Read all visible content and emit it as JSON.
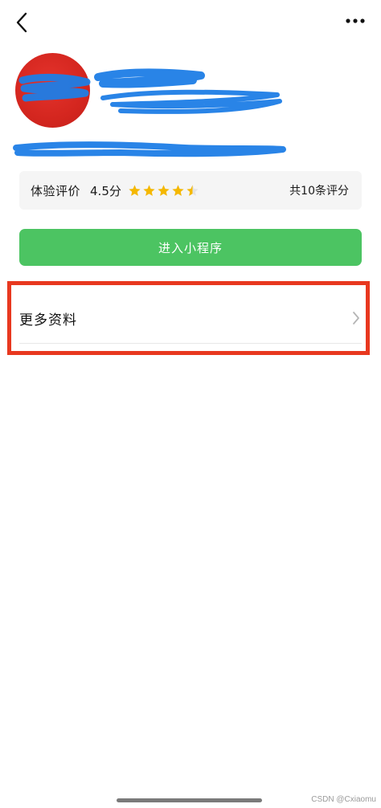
{
  "colors": {
    "accent_green": "#4cc462",
    "highlight_red": "#e8381f",
    "avatar_red": "#d4261f",
    "redaction_blue": "#1e7de6",
    "star_gold": "#f5b800"
  },
  "icons": {
    "back": "chevron-left-icon",
    "more": "more-dots-icon",
    "row_chevron": "chevron-right-icon",
    "star": "star-icon"
  },
  "rating": {
    "label": "体验评价",
    "score": "4.5分",
    "stars_value": 4.5,
    "stars_max": 5,
    "count_text": "共10条评分"
  },
  "enter_button": {
    "label": "进入小程序"
  },
  "more_info": {
    "label": "更多资料"
  },
  "watermark": "CSDN @Cxiaomu"
}
